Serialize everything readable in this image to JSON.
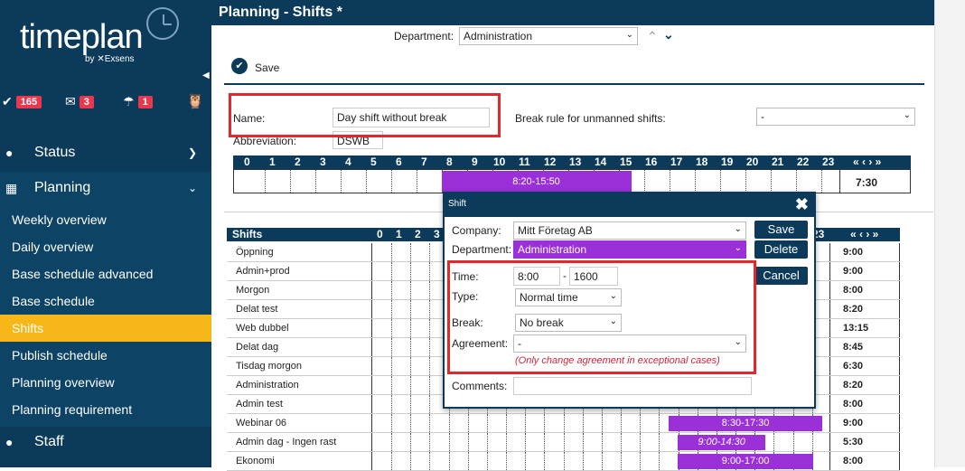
{
  "brand": {
    "logo": "timeplan",
    "by": "by ✕Exsens"
  },
  "badges": [
    {
      "icon": "check-icon",
      "count": "165"
    },
    {
      "icon": "mail-icon",
      "count": "3"
    },
    {
      "icon": "umbrella-icon",
      "count": "1"
    }
  ],
  "sidebar": {
    "status_label": "Status",
    "planning_label": "Planning",
    "staff_label": "Staff",
    "items": [
      "Weekly overview",
      "Daily overview",
      "Base schedule advanced",
      "Base schedule",
      "Shifts",
      "Publish schedule",
      "Planning overview",
      "Planning requirement"
    ]
  },
  "header": {
    "title": "Planning - Shifts *"
  },
  "top": {
    "department_label": "Department:",
    "department_value": "Administration",
    "save_label": "Save",
    "name_label": "Name:",
    "name_value": "Day shift without break",
    "abbrev_label": "Abbreviation:",
    "abbrev_value": "DSWB",
    "break_rule_label": "Break rule for unmanned shifts:",
    "break_rule_value": "-"
  },
  "timeline": {
    "hours": [
      "0",
      "1",
      "2",
      "3",
      "4",
      "5",
      "6",
      "7",
      "8",
      "9",
      "10",
      "11",
      "12",
      "13",
      "14",
      "15",
      "16",
      "17",
      "18",
      "19",
      "20",
      "21",
      "22",
      "23"
    ],
    "nav": "« ‹ › »",
    "bar_label": "8:20-15:50",
    "bar_start": 8.333,
    "bar_end": 15.833,
    "total": "7:30"
  },
  "shifts": {
    "title": "Shifts",
    "hours_visible": [
      "0",
      "1",
      "2",
      "3"
    ],
    "hour_23": "23",
    "nav": "« ‹ › »",
    "rows": [
      {
        "name": "Öppning",
        "total": "9:00"
      },
      {
        "name": "Admin+prod",
        "total": "9:00"
      },
      {
        "name": "Morgon",
        "total": "8:00"
      },
      {
        "name": "Delat test",
        "total": "8:20"
      },
      {
        "name": "Web dubbel",
        "total": "13:15"
      },
      {
        "name": "Delat dag",
        "total": "8:45"
      },
      {
        "name": "Tisdag morgon",
        "total": "6:30"
      },
      {
        "name": "Administration",
        "total": "8:20"
      },
      {
        "name": "Admin test",
        "total": "8:00"
      },
      {
        "name": "Webinar 06",
        "total": "9:00",
        "bar": "8:30-17:30",
        "bar_start": 8.5,
        "bar_end": 17.5
      },
      {
        "name": "Admin dag - Ingen rast",
        "total": "5:30",
        "bar": "9:00-14:30",
        "bar_start": 9,
        "bar_end": 14.5
      },
      {
        "name": "Ekonomi",
        "total": "8:00",
        "bar": "9:00-17:00",
        "bar_start": 9,
        "bar_end": 17
      }
    ]
  },
  "dialog": {
    "title": "Shift",
    "company_label": "Company:",
    "company_value": "Mitt Företag AB",
    "department_label": "Department:",
    "department_value": "Administration",
    "save": "Save",
    "delete": "Delete",
    "cancel": "Cancel",
    "time_label": "Time:",
    "time_from": "8:00",
    "time_sep": "-",
    "time_to": "1600",
    "type_label": "Type:",
    "type_value": "Normal time",
    "break_label": "Break:",
    "break_value": "No break",
    "agreement_label": "Agreement:",
    "agreement_value": "-",
    "agreement_hint": "(Only change agreement in exceptional cases)",
    "comments_label": "Comments:",
    "comments_value": ""
  },
  "colors": {
    "navy": "#0b3a5b",
    "accent": "#f7b718",
    "bar": "#9b30d9",
    "badge": "#e8384f",
    "highlight": "#e5262b"
  }
}
